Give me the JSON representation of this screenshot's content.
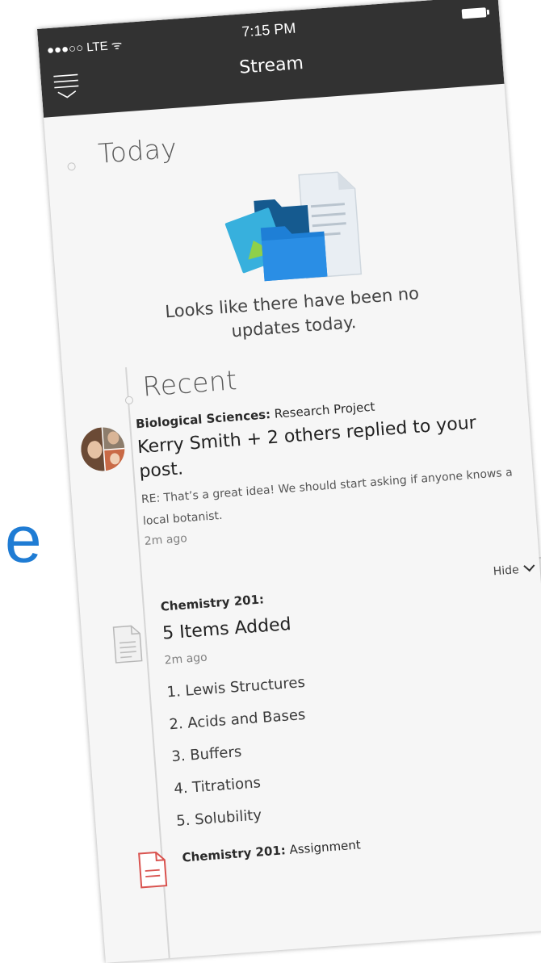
{
  "status_bar": {
    "carrier": "●●●○○ LTE ᯤ",
    "time": "7:15 PM"
  },
  "nav": {
    "title": "Stream",
    "menu_icon": "menu-icon"
  },
  "today": {
    "title": "Today",
    "empty_message": "Looks like there have been no updates today.",
    "illustration_icon": "folders-icon"
  },
  "recent": {
    "title": "Recent",
    "items": [
      {
        "course": "Biological Sciences:",
        "context": "Research Project",
        "headline": "Kerry Smith + 2 others replied to your post.",
        "snippet": "RE: That’s a great idea! We should start asking if anyone knows a local botanist.",
        "time": "2m ago",
        "icon": "avatar-group"
      },
      {
        "course": "Chemistry 201:",
        "headline": "5 Items Added",
        "time": "2m ago",
        "toggle": "Hide",
        "icon": "document-icon",
        "list": [
          "1. Lewis Structures",
          "2. Acids and Bases",
          "3. Buffers",
          "4. Titrations",
          "5. Solubility"
        ]
      },
      {
        "course": "Chemistry 201:",
        "context": "Assignment",
        "icon": "assignment-icon"
      }
    ]
  },
  "background": {
    "partial_letter": "e"
  },
  "colors": {
    "top_bar": "#323232",
    "background": "#f6f6f6",
    "accent_blue": "#1f7cd4",
    "assignment_red": "#d9534f"
  }
}
